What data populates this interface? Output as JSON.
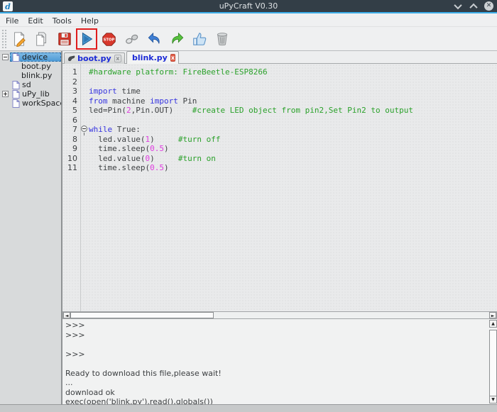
{
  "window": {
    "title": "uPyCraft V0.30",
    "logo_glyph": "d",
    "controls": [
      "minimize",
      "maximize",
      "close"
    ],
    "close_glyph": "✕"
  },
  "menu": {
    "items": [
      "File",
      "Edit",
      "Tools",
      "Help"
    ]
  },
  "toolbar": {
    "icons": [
      "new-file",
      "open-file",
      "save-file",
      "download-run",
      "stop",
      "connect-serial",
      "undo",
      "redo",
      "syntax-check",
      "clear"
    ],
    "active_icon": "download-run"
  },
  "sidebar": {
    "items": [
      {
        "label": "device",
        "depth": 0,
        "expander": "minus",
        "icon": "file",
        "selected": true
      },
      {
        "label": "boot.py",
        "depth": 1,
        "expander": null,
        "icon": null,
        "selected": false
      },
      {
        "label": "blink.py",
        "depth": 1,
        "expander": null,
        "icon": null,
        "selected": false
      },
      {
        "label": "sd",
        "depth": 0,
        "expander": null,
        "icon": "file",
        "selected": false
      },
      {
        "label": "uPy_lib",
        "depth": 0,
        "expander": "plus",
        "icon": "file",
        "selected": false
      },
      {
        "label": "workSpace",
        "depth": 0,
        "expander": null,
        "icon": "file",
        "selected": false
      }
    ]
  },
  "tabs": [
    {
      "label": "boot.py",
      "icon": "device-file-icon",
      "active": false,
      "close_style": "gray",
      "close_glyph": "x"
    },
    {
      "label": "blink.py",
      "icon": "laptop-icon",
      "active": true,
      "close_style": "red",
      "close_glyph": "x"
    }
  ],
  "editor": {
    "lines": [
      {
        "num": 1,
        "fold": false,
        "segments": [
          {
            "t": "#hardware platform: FireBeetle-ESP8266",
            "c": "cm"
          }
        ]
      },
      {
        "num": 2,
        "fold": false,
        "segments": []
      },
      {
        "num": 3,
        "fold": false,
        "segments": [
          {
            "t": "import",
            "c": "kw"
          },
          {
            "t": " time",
            "c": "tx"
          }
        ]
      },
      {
        "num": 4,
        "fold": false,
        "segments": [
          {
            "t": "from",
            "c": "kw"
          },
          {
            "t": " machine ",
            "c": "tx"
          },
          {
            "t": "import",
            "c": "kw"
          },
          {
            "t": " Pin",
            "c": "tx"
          }
        ]
      },
      {
        "num": 5,
        "fold": false,
        "segments": [
          {
            "t": "led=Pin(",
            "c": "tx"
          },
          {
            "t": "2",
            "c": "num"
          },
          {
            "t": ",Pin.OUT)    ",
            "c": "tx"
          },
          {
            "t": "#create LED object from pin2,Set Pin2 to output",
            "c": "cm"
          }
        ]
      },
      {
        "num": 6,
        "fold": false,
        "segments": []
      },
      {
        "num": 7,
        "fold": true,
        "segments": [
          {
            "t": "while",
            "c": "kw"
          },
          {
            "t": " True:",
            "c": "tx"
          }
        ]
      },
      {
        "num": 8,
        "fold": false,
        "segments": [
          {
            "t": "  led.value(",
            "c": "tx"
          },
          {
            "t": "1",
            "c": "num"
          },
          {
            "t": ")     ",
            "c": "tx"
          },
          {
            "t": "#turn off",
            "c": "cm"
          }
        ]
      },
      {
        "num": 9,
        "fold": false,
        "segments": [
          {
            "t": "  time.sleep(",
            "c": "tx"
          },
          {
            "t": "0.5",
            "c": "num"
          },
          {
            "t": ")",
            "c": "tx"
          }
        ]
      },
      {
        "num": 10,
        "fold": false,
        "segments": [
          {
            "t": "  led.value(",
            "c": "tx"
          },
          {
            "t": "0",
            "c": "num"
          },
          {
            "t": ")     ",
            "c": "tx"
          },
          {
            "t": "#turn on",
            "c": "cm"
          }
        ]
      },
      {
        "num": 11,
        "fold": false,
        "segments": [
          {
            "t": "  time.sleep(",
            "c": "tx"
          },
          {
            "t": "0.5",
            "c": "num"
          },
          {
            "t": ")",
            "c": "tx"
          }
        ]
      }
    ]
  },
  "console": {
    "lines": [
      ">>>",
      ">>>",
      "",
      ">>>",
      "",
      "Ready to download this file,please wait!",
      "...",
      "download ok",
      "exec(open('blink.py').read(),globals())"
    ]
  },
  "colors": {
    "titlebar_bg": "#333e47",
    "accent": "#3daee9",
    "keyword": "#3533e0",
    "number": "#e03ce0",
    "comment": "#2aa12a",
    "tab_label": "#1b2ad6",
    "selection_blue": "#4f9bd6",
    "sidebar_bg": "#d8dadb",
    "editor_bg": "#e9eaeb"
  }
}
